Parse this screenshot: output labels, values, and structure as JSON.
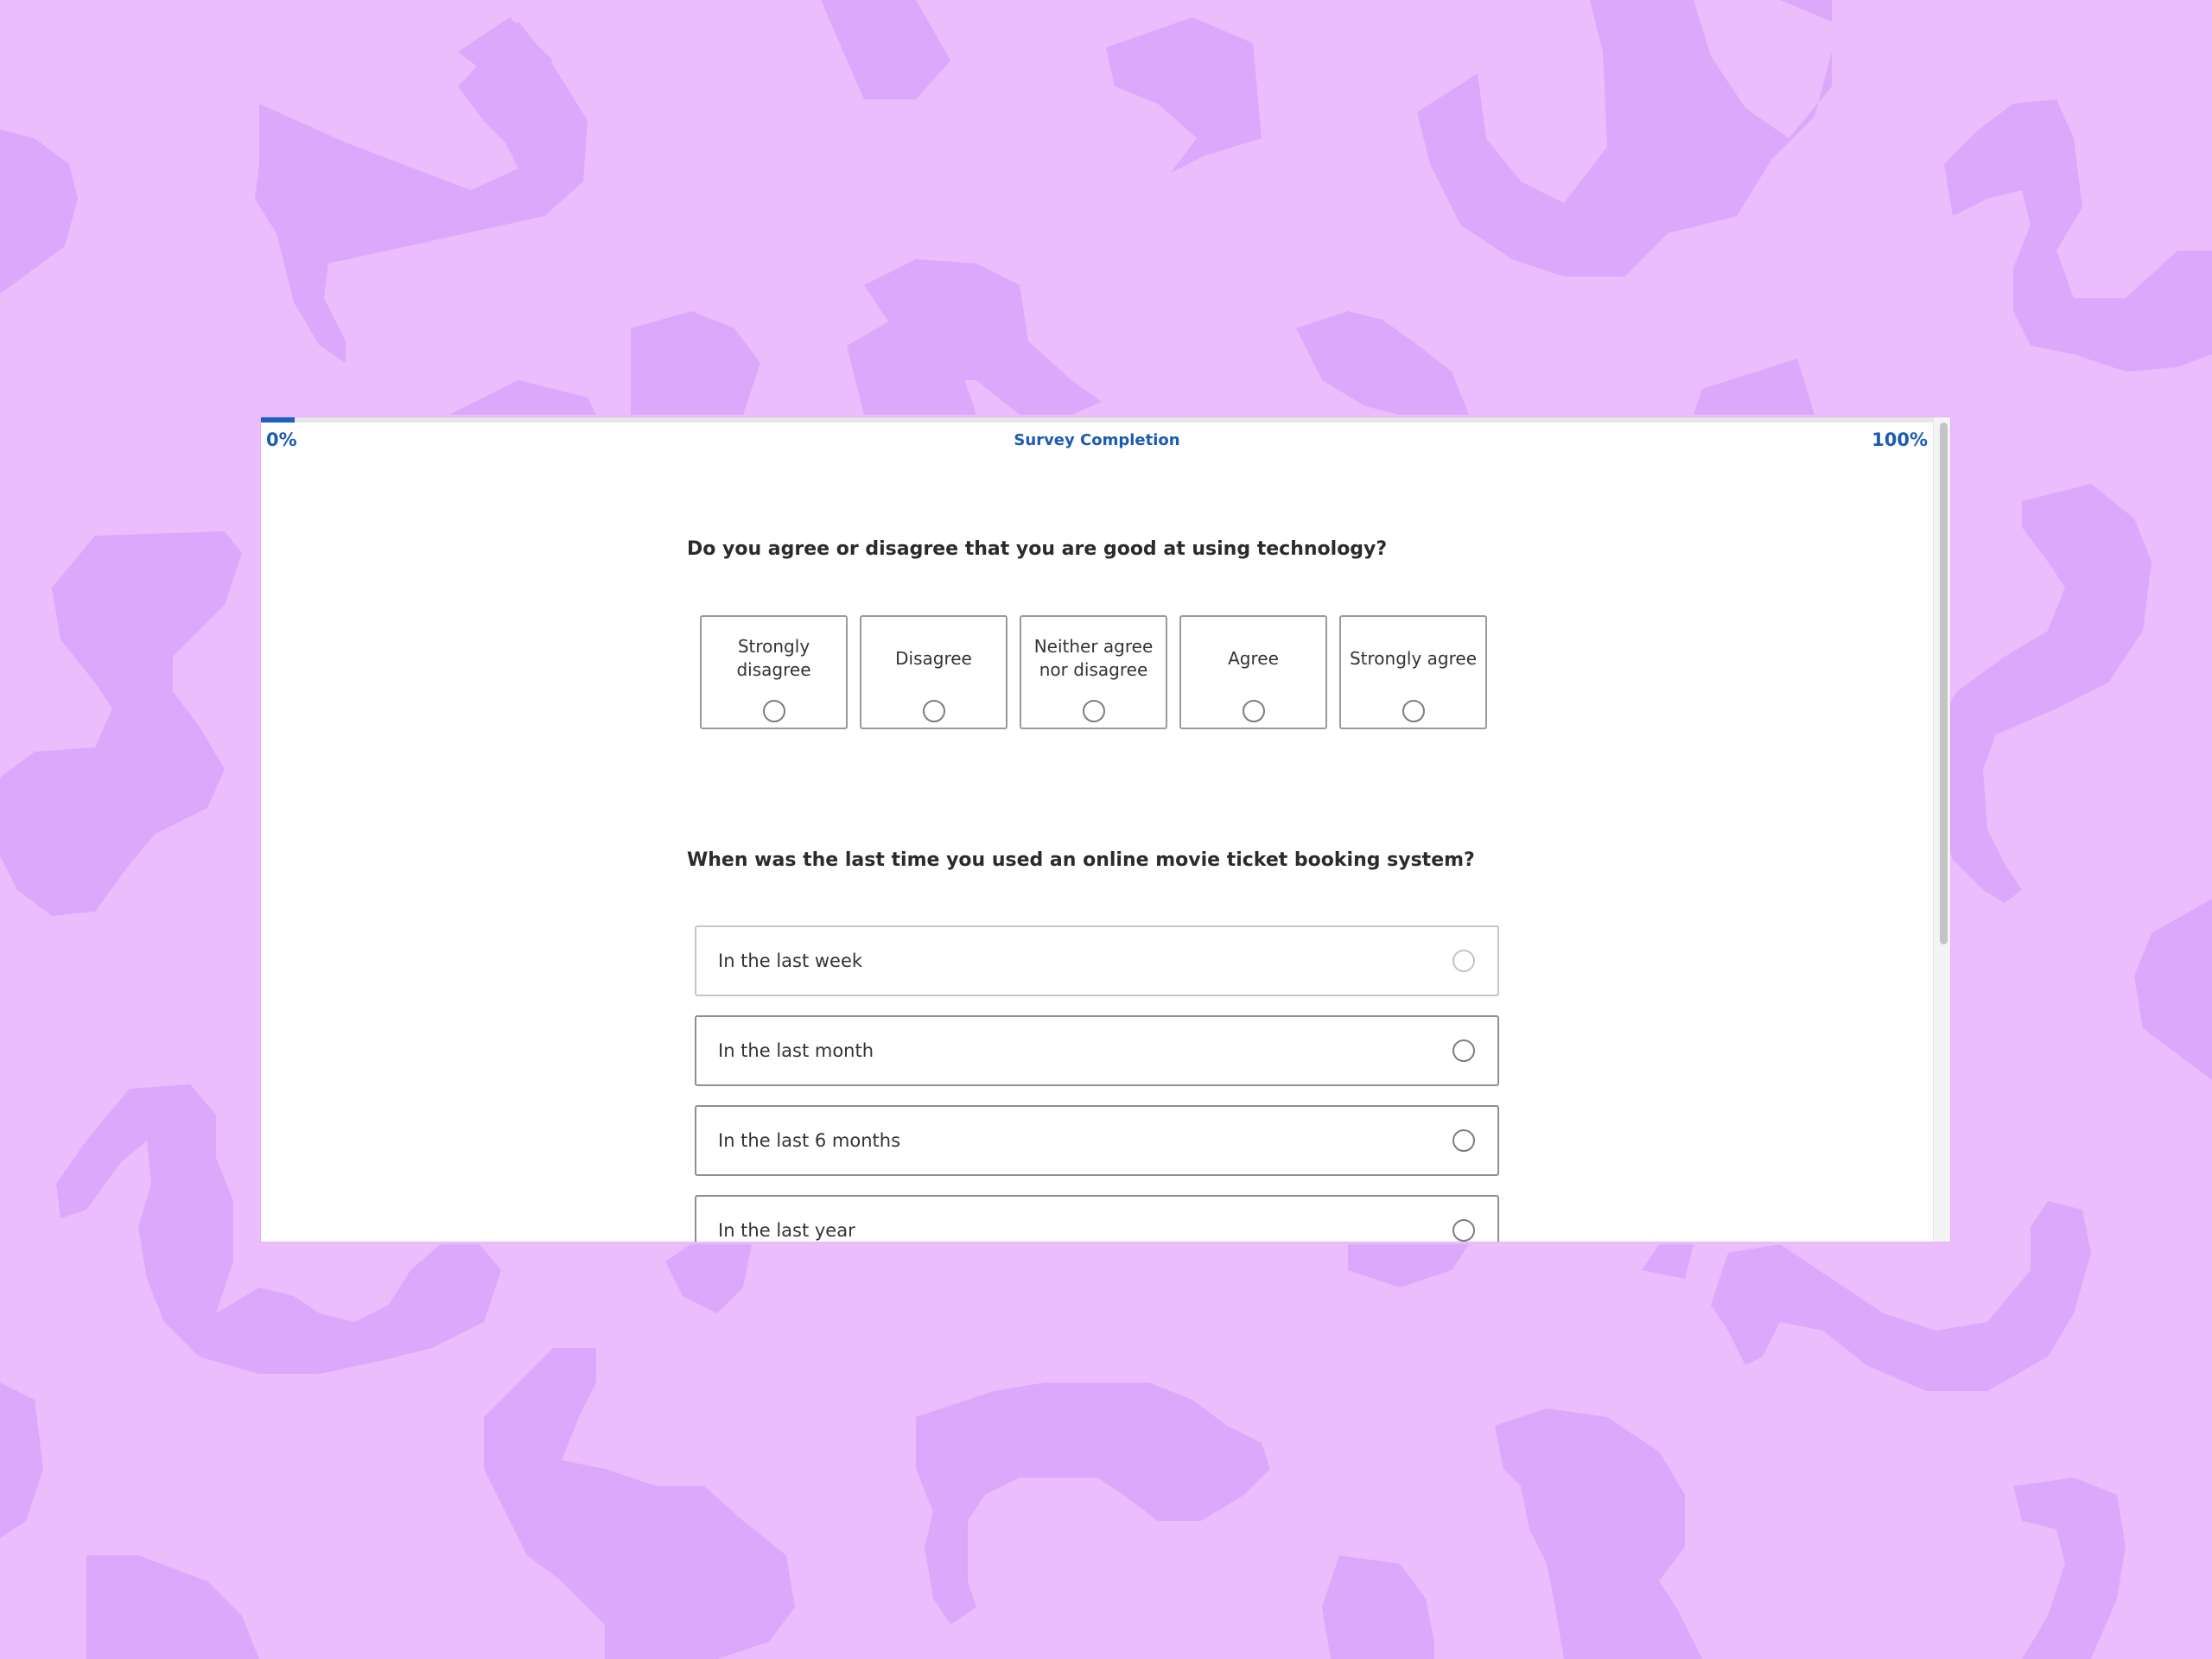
{
  "colors": {
    "background": "#ebbdfc",
    "background_shapes": "#dca8fb",
    "accent": "#1c5bb3",
    "panel": "#ffffff",
    "border": "#9a9a9a",
    "text": "#2b2b2b"
  },
  "progress": {
    "start_label": "0%",
    "title": "Survey Completion",
    "end_label": "100%",
    "value_percent": 2
  },
  "question1": {
    "text": "Do you agree or disagree that you are good at using technology?",
    "options": [
      {
        "label": "Strongly disagree",
        "selected": false
      },
      {
        "label": "Disagree",
        "selected": false
      },
      {
        "label": "Neither agree nor disagree",
        "selected": false
      },
      {
        "label": "Agree",
        "selected": false
      },
      {
        "label": "Strongly agree",
        "selected": false
      }
    ]
  },
  "question2": {
    "text": "When was the last time you used an online movie ticket booking system?",
    "options": [
      {
        "label": "In the last week",
        "selected": false
      },
      {
        "label": "In the last month",
        "selected": false
      },
      {
        "label": "In the last 6 months",
        "selected": false
      },
      {
        "label": "In the last year",
        "selected": false
      }
    ]
  },
  "icons": {
    "radio": "radio-unselected-icon"
  }
}
